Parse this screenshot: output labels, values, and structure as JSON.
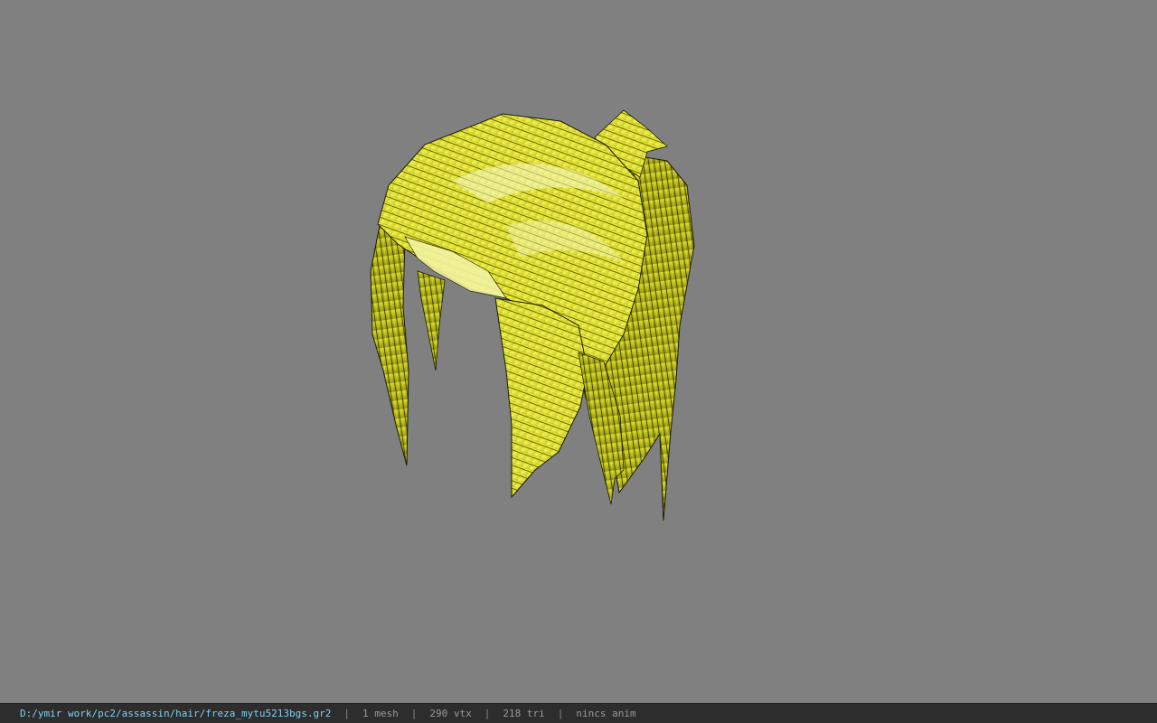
{
  "viewport": {
    "background": "#808080",
    "model": {
      "name": "hair-mesh",
      "primary_color": "#e7e81e",
      "highlight_color": "#f4f5a8",
      "shadow_color": "#1d1f05"
    }
  },
  "status": {
    "path": "D:/ymir work/pc2/assassin/hair/freza_mytu5213bgs.gr2",
    "separator": "|",
    "mesh_count": "1 mesh",
    "vertex_count": "290 vtx",
    "triangle_count": "218 tri",
    "anim": "nincs anim",
    "path_color": "#7fd2ef"
  }
}
